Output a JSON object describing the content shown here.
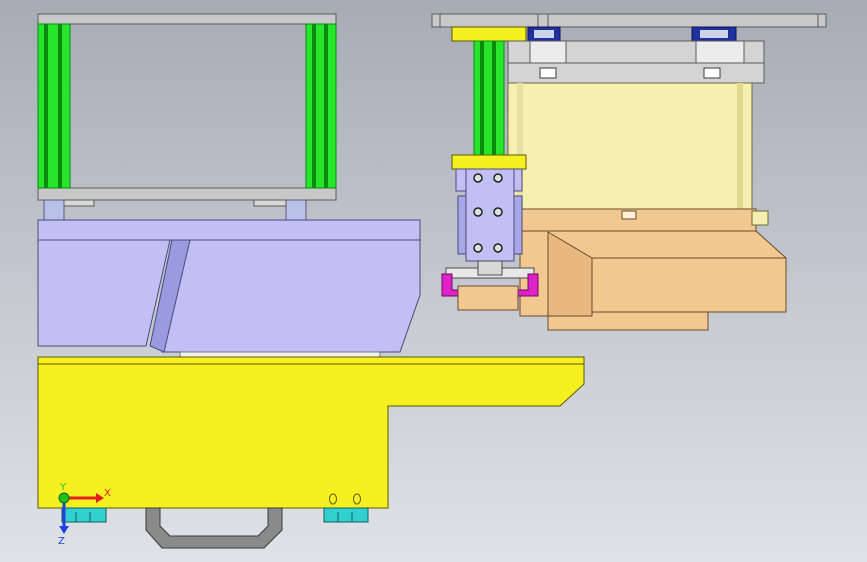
{
  "viewport": {
    "background_top": "#a6acb5",
    "background_bottom": "#dfe2e6"
  },
  "colors": {
    "steel": "#c8c8c8",
    "steel_edge": "#5a5a5a",
    "lavender": "#c0c0f4",
    "lavender_dark": "#9a9ae0",
    "yellow": "#f7f020",
    "yellow_dark": "#d8d000",
    "green": "#27e52b",
    "green_dark": "#0a8a10",
    "cream": "#f6f0b0",
    "peach": "#f0c890",
    "magenta": "#e020c8",
    "cyan": "#30d0d0",
    "navy": "#2030a0"
  },
  "triad": {
    "x_label": "X",
    "y_label": "Y",
    "z_label": "Z",
    "x_color": "#e02020",
    "y_color": "#20c020",
    "z_color": "#2040e0"
  }
}
